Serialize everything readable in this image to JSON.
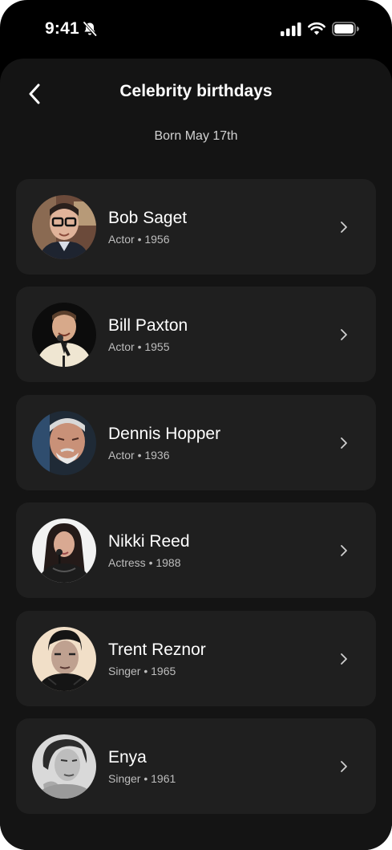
{
  "status_bar": {
    "time": "9:41",
    "icons": [
      "bell-off-icon",
      "signal-icon",
      "wifi-icon",
      "battery-icon"
    ]
  },
  "header": {
    "title": "Celebrity birthdays",
    "subtitle": "Born May 17th",
    "back_icon": "chevron-left-icon"
  },
  "celebrities": [
    {
      "name": "Bob Saget",
      "role": "Actor",
      "year": "1956",
      "meta": "Actor • 1956"
    },
    {
      "name": "Bill Paxton",
      "role": "Actor",
      "year": "1955",
      "meta": "Actor • 1955"
    },
    {
      "name": "Dennis Hopper",
      "role": "Actor",
      "year": "1936",
      "meta": "Actor • 1936"
    },
    {
      "name": "Nikki Reed",
      "role": "Actress",
      "year": "1988",
      "meta": "Actress • 1988"
    },
    {
      "name": "Trent Reznor",
      "role": "Singer",
      "year": "1965",
      "meta": "Singer • 1965"
    },
    {
      "name": "Enya",
      "role": "Singer",
      "year": "1961",
      "meta": "Singer • 1961"
    }
  ],
  "colors": {
    "background": "#000000",
    "sheet": "#141414",
    "card": "#1f1f1f",
    "text_primary": "#ffffff",
    "text_secondary": "#bdbdbd"
  }
}
